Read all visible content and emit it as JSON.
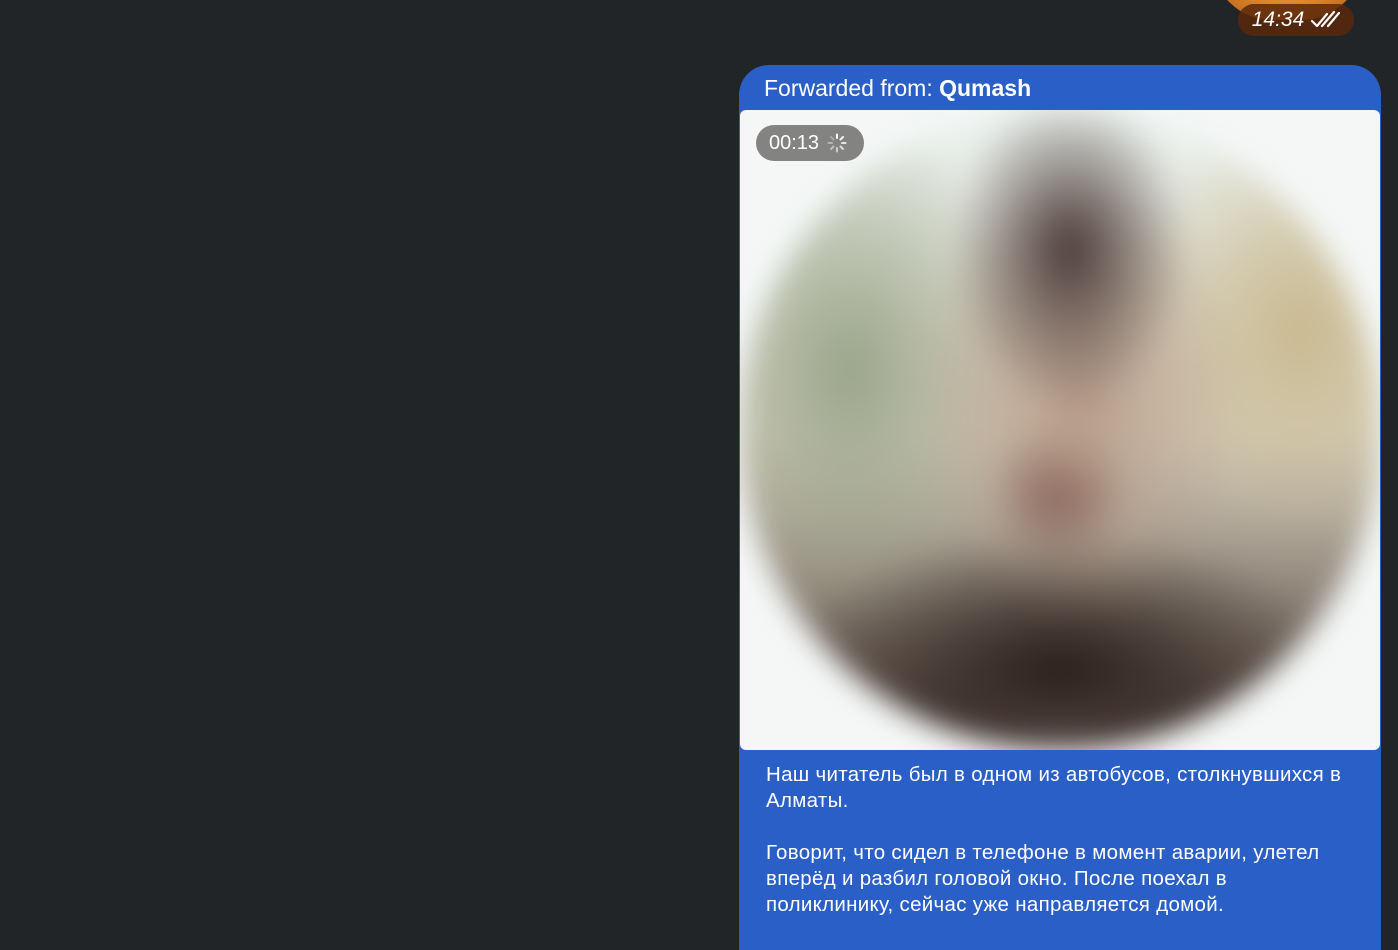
{
  "previous_message": {
    "time": "14:34",
    "status_icon": "double-check-icon"
  },
  "message": {
    "forwarded_label": "Forwarded from:",
    "forwarded_name": "Qumash",
    "video": {
      "duration": "00:13",
      "loading_icon": "spinner-icon"
    },
    "caption": {
      "paragraph_1": "Наш читатель был в одном из автобусов, столкнувшихся в Алматы.",
      "paragraph_2": "Говорит, что сидел в телефоне в момент аварии, улетел вперёд и разбил головой окно. После поехал в поликлинику, сейчас уже направляется домой."
    }
  },
  "colors": {
    "background": "#222528",
    "bubble": "#2a5fc7",
    "time_badge": "#5a280a"
  }
}
